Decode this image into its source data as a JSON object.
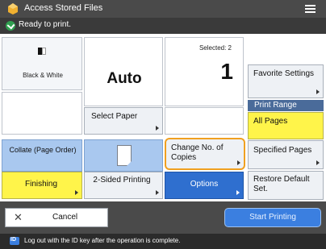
{
  "title_bar": {
    "title": "Access Stored Files",
    "app_icon": "stored-files-icon",
    "menu_icon": "hamburger-menu-icon"
  },
  "status": {
    "text": "Ready to print.",
    "icon": "ready-check-icon",
    "icon_color": "#2f9f4f"
  },
  "color_mode": {
    "label": "Black & White",
    "icon": "black-white-icon"
  },
  "paper": {
    "value": "Auto",
    "select_label": "Select Paper"
  },
  "copies": {
    "selected_label": "Selected: 2",
    "count": "1",
    "change_label": "Change No. of Copies"
  },
  "right_panel": {
    "favorite_label": "Favorite Settings",
    "print_range_heading": "Print Range",
    "all_pages_label": "All Pages",
    "specified_pages_label": "Specified Pages",
    "restore_label": "Restore Default Set."
  },
  "finishing": {
    "collate_label": "Collate (Page Order)",
    "finishing_label": "Finishing"
  },
  "two_sided": {
    "label": "2-Sided Printing",
    "icon": "document-icon"
  },
  "options": {
    "label": "Options"
  },
  "bottom": {
    "cancel_label": "Cancel",
    "start_label": "Start Printing"
  },
  "footer": {
    "text": "Log out with the ID key after the operation is complete.",
    "icon": "id-key-icon"
  },
  "colors": {
    "accent_blue": "#2f6fcf",
    "highlight_yellow": "#fff44a",
    "focus_orange": "#f0a020",
    "light_blue": "#a9c8ef"
  }
}
